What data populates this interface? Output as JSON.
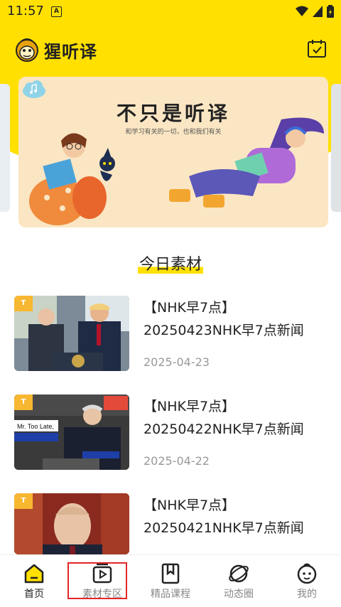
{
  "status_bar": {
    "time": "11:57",
    "badge": "A"
  },
  "header": {
    "app_name": "猩听译",
    "calendar_icon": "calendar-icon",
    "colors": {
      "brand_yellow": "#ffe000"
    }
  },
  "banner": {
    "title": "不只是听译",
    "subtitle": "和学习有关的一切，也和我们有关"
  },
  "section": {
    "title": "今日素材"
  },
  "news": [
    {
      "title_line1": "【NHK早7点】",
      "title_line2": "20250423NHK早7点新闻",
      "date": "2025-04-23",
      "badge": "T"
    },
    {
      "title_line1": "【NHK早7点】",
      "title_line2": "20250422NHK早7点新闻",
      "date": "2025-04-22",
      "badge": "T",
      "thumb_text": "Mr. Too Late,"
    },
    {
      "title_line1": "【NHK早7点】",
      "title_line2": "20250421NHK早7点新闻",
      "date": "",
      "badge": "T"
    }
  ],
  "bottom_nav": {
    "items": [
      {
        "label": "首页",
        "icon": "home-icon",
        "active": true
      },
      {
        "label": "素材专区",
        "icon": "video-folder-icon",
        "active": false
      },
      {
        "label": "精品课程",
        "icon": "bookmark-icon",
        "active": false
      },
      {
        "label": "动态圈",
        "icon": "planet-icon",
        "active": false
      },
      {
        "label": "我的",
        "icon": "face-icon",
        "active": false
      }
    ]
  }
}
